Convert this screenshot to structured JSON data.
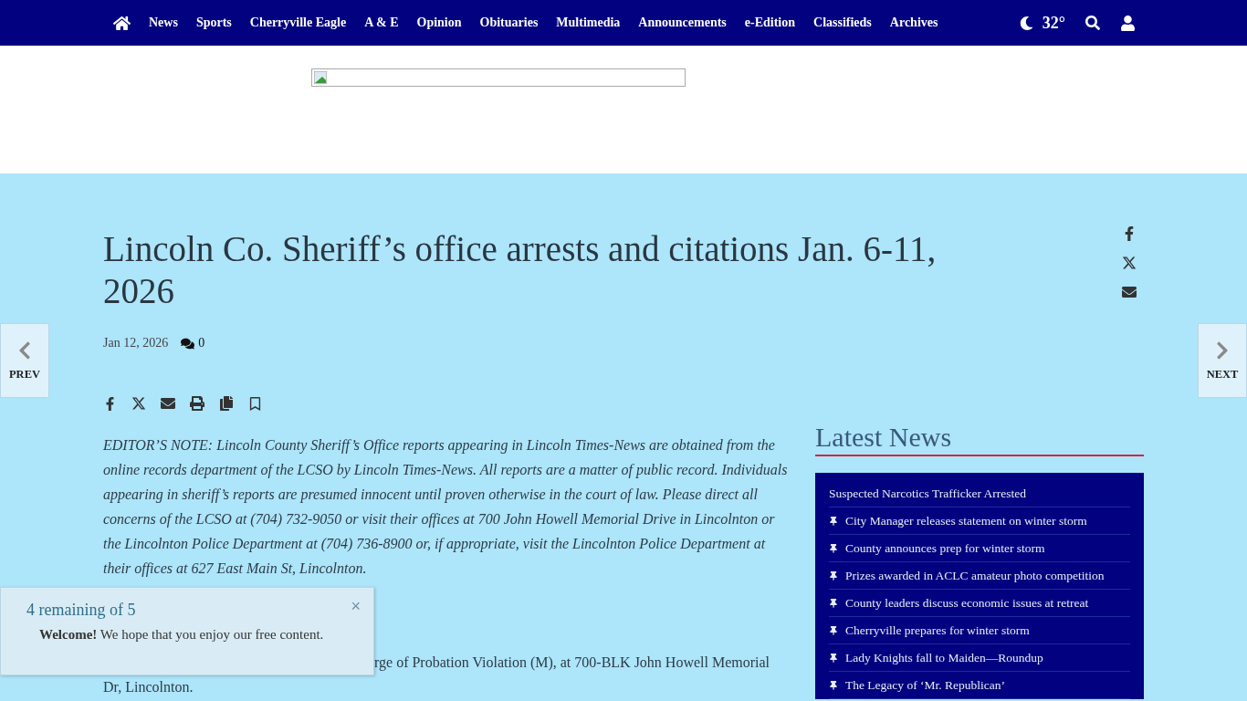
{
  "nav": {
    "items": [
      {
        "label": "News"
      },
      {
        "label": "Sports"
      },
      {
        "label": "Cherryville Eagle"
      },
      {
        "label": "A & E"
      },
      {
        "label": "Opinion"
      },
      {
        "label": "Obituaries"
      },
      {
        "label": "Multimedia"
      },
      {
        "label": "Announcements"
      },
      {
        "label": "e-Edition"
      },
      {
        "label": "Classifieds"
      },
      {
        "label": "Archives"
      }
    ],
    "temperature": "32°"
  },
  "ad": {
    "kind": "broken-image"
  },
  "article": {
    "title": "Lincoln Co. Sheriff’s office arrests and citations Jan. 6-11, 2026",
    "date": "Jan 12, 2026",
    "comments": "0",
    "paragraphs": [
      {
        "kind": "note",
        "text": "EDITOR’S NOTE: Lincoln County Sheriff’s Office reports appearing in Lincoln Times-News are obtained from the online records department of the LCSO by Lincoln Times-News. All reports are a matter of public record. Individuals appearing in sheriff’s reports are presumed innocent until proven otherwise in the court of law. Please direct all concerns of the LCSO at (704) 732-9050 or visit their offices at 700 John Howell Memorial Drive in Lincolnton or the Lincolnton Police Department at (704) 736-8900 or, if appropriate, visit the Lincolnton Police Department at their offices at 627 East Main St, Lincolnton."
      },
      {
        "kind": "partial",
        "text": "rge of Probation Violation (M), at 700-BLK John Howell Memorial Dr, Lincolnton."
      }
    ]
  },
  "pager": {
    "prev": "PREV",
    "next": "NEXT"
  },
  "sidebar": {
    "title": "Latest News",
    "items": [
      {
        "kind": "lead",
        "text": "Suspected Narcotics Trafficker Arrested"
      },
      {
        "kind": "pinned",
        "text": "City Manager releases statement on winter storm"
      },
      {
        "kind": "pinned",
        "text": "County announces prep for winter storm"
      },
      {
        "kind": "pinned",
        "text": "Prizes awarded in ACLC amateur photo competition"
      },
      {
        "kind": "pinned",
        "text": "County leaders discuss economic issues at retreat"
      },
      {
        "kind": "pinned",
        "text": "Cherryville prepares for winter storm"
      },
      {
        "kind": "pinned",
        "text": "Lady Knights fall to Maiden—Roundup"
      },
      {
        "kind": "pinned",
        "text": "The Legacy of ‘Mr. Republican’"
      }
    ]
  },
  "meter": {
    "counter": "4 remaining of 5",
    "close": "×",
    "message": "**Welcome!** We hope that you enjoy our free content."
  }
}
